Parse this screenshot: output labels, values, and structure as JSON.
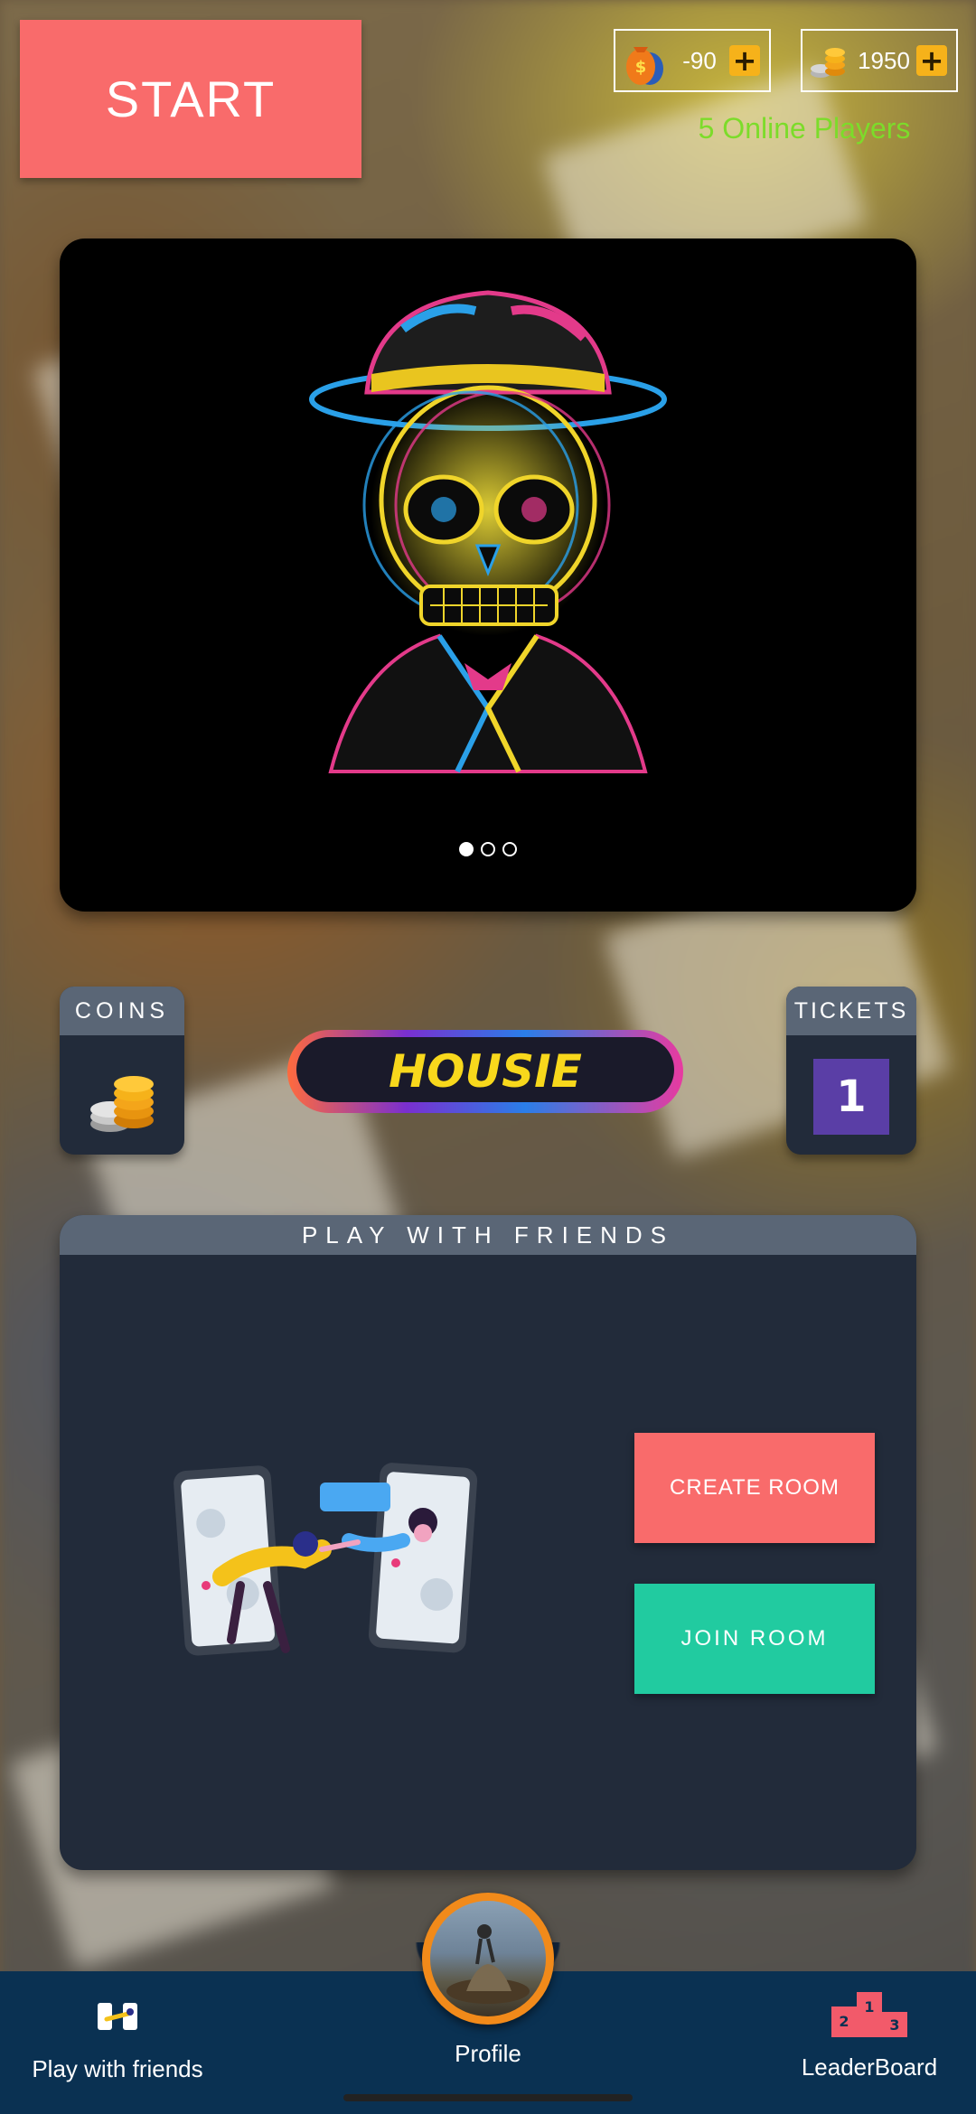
{
  "header": {
    "start_label": "START",
    "cash": {
      "icon": "money-bag-icon",
      "value": "-90"
    },
    "coins": {
      "icon": "coin-stack-icon",
      "value": "1950"
    },
    "online_players": "5 Online Players"
  },
  "banner": {
    "image": "neon-skull-with-bowler-hat",
    "slides": 3,
    "active_slide": 1
  },
  "coins_card": {
    "title": "COINS",
    "icon": "coin-stack-icon"
  },
  "logo": {
    "text": "HOUSIE"
  },
  "tickets_card": {
    "title": "TICKETS",
    "count": "1"
  },
  "friends_panel": {
    "title": "PLAY WITH FRIENDS",
    "illustration": "friends-on-phones-illustration",
    "create_room": "CREATE ROOM",
    "join_room": "JOIN ROOM"
  },
  "navbar": {
    "items": [
      {
        "label": "Play with friends",
        "icon": "play-with-friends-icon"
      },
      {
        "label": "Profile",
        "icon": "profile-avatar"
      },
      {
        "label": "LeaderBoard",
        "icon": "podium-icon"
      }
    ]
  },
  "colors": {
    "accent_red": "#f96b6b",
    "accent_green": "#21cba0",
    "online_green": "#7cdc2a",
    "panel": "#222b3a",
    "nav": "#0a3152"
  }
}
